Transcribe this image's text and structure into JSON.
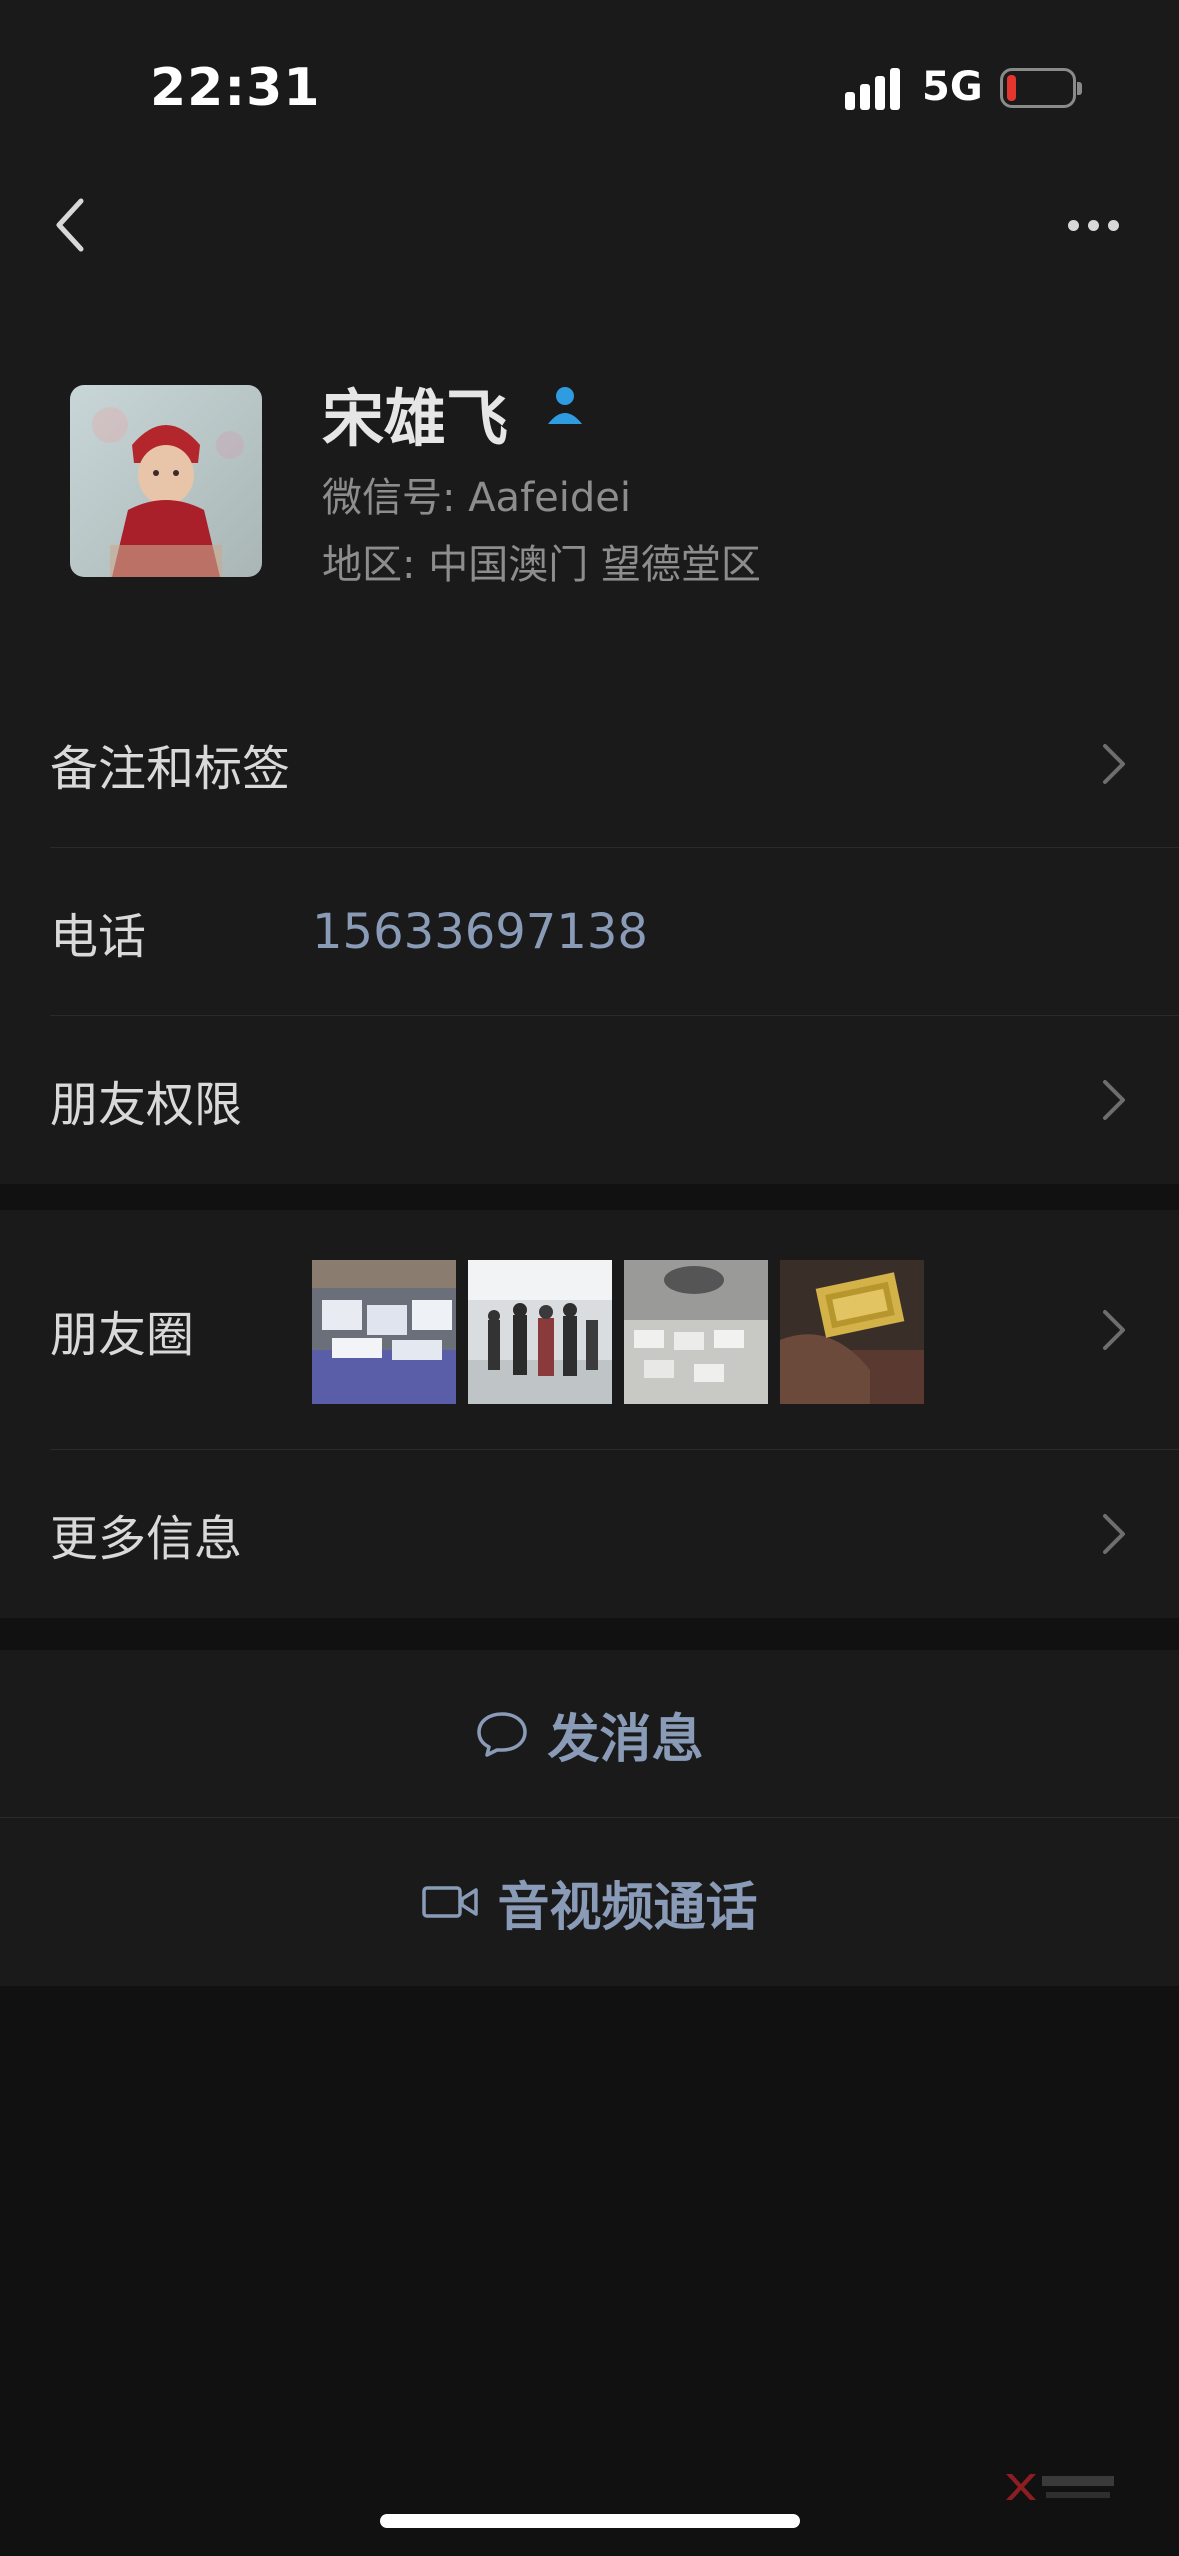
{
  "status_bar": {
    "time": "22:31",
    "network": "5G"
  },
  "profile": {
    "name": "宋雄飞",
    "wechat_id": "微信号: Aafeidei",
    "region": "地区: 中国澳门 望德堂区"
  },
  "rows": {
    "remark": "备注和标签",
    "phone_label": "电话",
    "phone_value": "15633697138",
    "permissions": "朋友权限",
    "moments": "朋友圈",
    "more_info": "更多信息"
  },
  "actions": {
    "message": "发消息",
    "call": "音视频通话"
  },
  "colors": {
    "background": "#111111",
    "panel": "#1a1a1a",
    "link": "#8a9bb8",
    "accent": "#1aad19"
  }
}
